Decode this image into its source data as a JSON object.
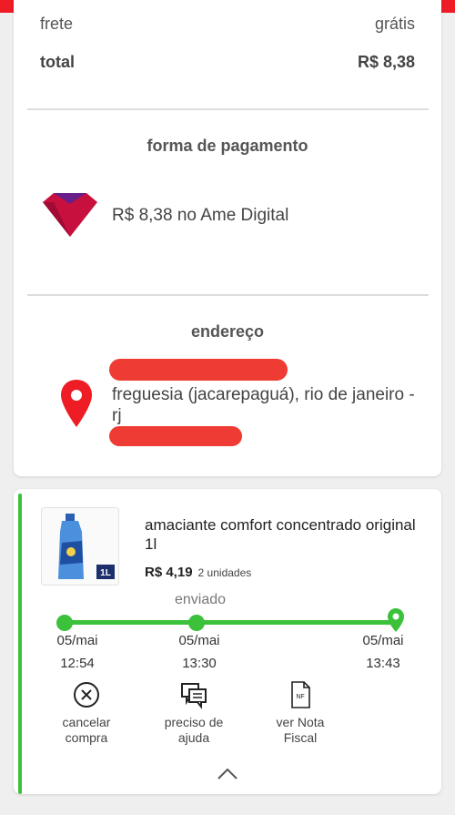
{
  "summary": {
    "frete_label": "frete",
    "frete_value": "grátis",
    "total_label": "total",
    "total_value": "R$ 8,38"
  },
  "payment": {
    "title": "forma de pagamento",
    "text": "R$ 8,38 no Ame Digital",
    "logo_icon": "ame-digital-logo",
    "logo_color": "#c8103e"
  },
  "address": {
    "title": "endereço",
    "line": "freguesia (jacarepaguá), rio de janeiro - rj",
    "pin_icon": "map-pin-icon",
    "pin_color": "#ee1c25"
  },
  "order": {
    "product_name": "amaciante comfort concentrado original 1l",
    "price": "R$ 4,19",
    "units": "2 unidades",
    "status": "enviado",
    "thumb_badge": "1L",
    "accent_color": "#3cc13b",
    "timeline": [
      {
        "date": "05/mai",
        "time": "12:54"
      },
      {
        "date": "05/mai",
        "time": "13:30"
      },
      {
        "date": "05/mai",
        "time": "13:43"
      }
    ],
    "actions": [
      {
        "label": "cancelar\ncompra",
        "icon": "cancel-circle-icon"
      },
      {
        "label": "preciso de\najuda",
        "icon": "chat-help-icon"
      },
      {
        "label": "ver Nota\nFiscal",
        "icon": "invoice-document-icon",
        "icon_text": "NF"
      }
    ],
    "collapse_icon": "chevron-up-icon"
  }
}
